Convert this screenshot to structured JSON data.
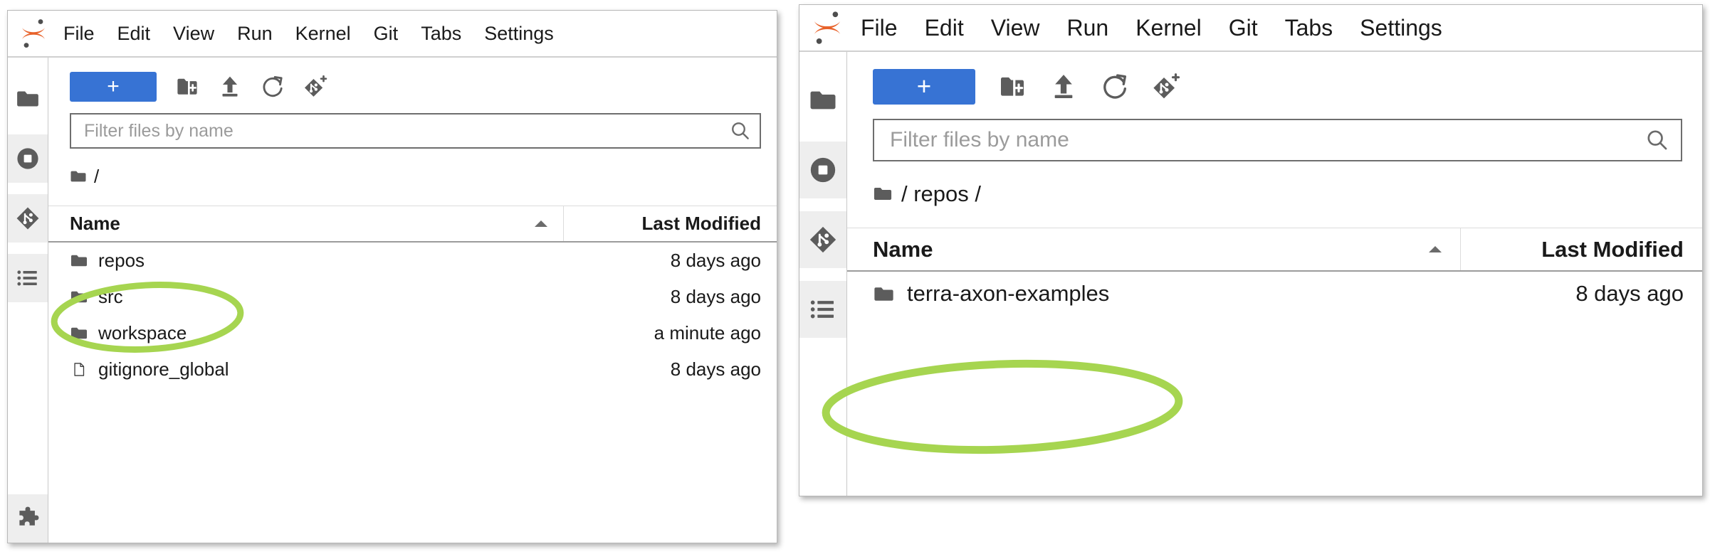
{
  "app": {
    "name": "JupyterLab",
    "logo_icon": "jupyter-logo-icon",
    "accent_color": "#3773d4",
    "annotation_color": "#a6d550",
    "icon_color": "#5c5c5c"
  },
  "annotations": [
    {
      "shape": "ellipse",
      "color": "#a6d550",
      "targets": "repos"
    },
    {
      "shape": "ellipse",
      "color": "#a6d550",
      "targets": "terra-axon-examples"
    }
  ],
  "menu": {
    "items": [
      {
        "label": "File"
      },
      {
        "label": "Edit"
      },
      {
        "label": "View"
      },
      {
        "label": "Run"
      },
      {
        "label": "Kernel"
      },
      {
        "label": "Git"
      },
      {
        "label": "Tabs"
      },
      {
        "label": "Settings"
      }
    ]
  },
  "sidebar": {
    "items": [
      {
        "icon": "folder-icon",
        "name": "file-browser",
        "active": false
      },
      {
        "icon": "stop-circle-icon",
        "name": "running-terminals-and-kernels",
        "active": true
      },
      {
        "icon": "git-icon",
        "name": "git-panel",
        "active": true
      },
      {
        "icon": "list-icon",
        "name": "table-of-contents",
        "active": true
      },
      {
        "icon": "puzzle-icon",
        "name": "extension-manager",
        "active": true
      }
    ]
  },
  "toolbar": {
    "new_launcher_label": "+",
    "buttons": [
      {
        "icon": "new-folder-icon",
        "name": "new-folder-button"
      },
      {
        "icon": "upload-icon",
        "name": "upload-files-button"
      },
      {
        "icon": "refresh-icon",
        "name": "refresh-file-list-button"
      },
      {
        "icon": "git-clone-icon",
        "name": "git-clone-button"
      }
    ]
  },
  "panels": [
    {
      "name": "before-opening-repos",
      "filter": {
        "placeholder": "Filter files by name",
        "value": ""
      },
      "breadcrumb": "/",
      "table": {
        "columns": [
          "Name",
          "Last Modified"
        ],
        "sort": {
          "column": "Name",
          "direction": "ascending"
        },
        "rows": [
          {
            "icon": "folder-icon",
            "name": "repos",
            "last_modified": "8 days ago",
            "highlighted": true
          },
          {
            "icon": "folder-icon",
            "name": "src",
            "last_modified": "8 days ago",
            "highlighted": false
          },
          {
            "icon": "folder-icon",
            "name": "workspace",
            "last_modified": "a minute ago",
            "highlighted": false
          },
          {
            "icon": "file-icon",
            "name": "gitignore_global",
            "last_modified": "8 days ago",
            "highlighted": false
          }
        ]
      }
    },
    {
      "name": "after-opening-repos",
      "filter": {
        "placeholder": "Filter files by name",
        "value": ""
      },
      "breadcrumb": "/ repos /",
      "table": {
        "columns": [
          "Name",
          "Last Modified"
        ],
        "sort": {
          "column": "Name",
          "direction": "ascending"
        },
        "rows": [
          {
            "icon": "folder-icon",
            "name": "terra-axon-examples",
            "last_modified": "8 days ago",
            "highlighted": true
          }
        ]
      }
    }
  ]
}
